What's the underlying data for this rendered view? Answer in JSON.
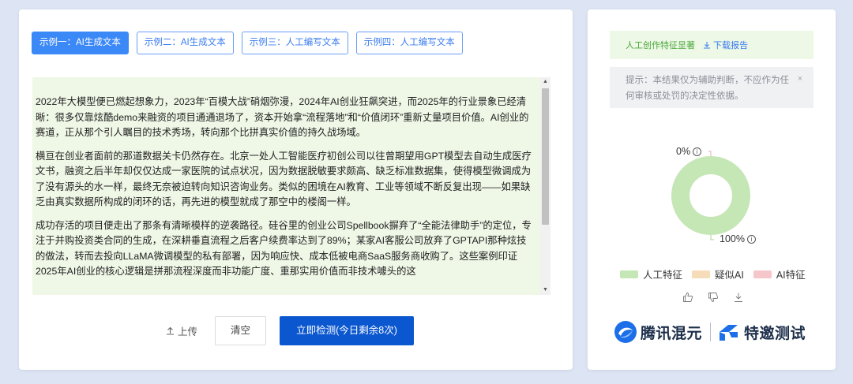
{
  "tabs": [
    {
      "label": "示例一：AI生成文本",
      "active": true
    },
    {
      "label": "示例二：AI生成文本",
      "active": false
    },
    {
      "label": "示例三：人工编写文本",
      "active": false
    },
    {
      "label": "示例四：人工编写文本",
      "active": false
    }
  ],
  "content": {
    "paragraphs": [
      "2022年大模型便已燃起想象力，2023年“百模大战”硝烟弥漫，2024年AI创业狂飙突进，而2025年的行业景象已经清晰：很多仅靠炫酷demo来融资的项目通通退场了，资本开始拿“流程落地”和“价值闭环”重新丈量项目价值。AI创业的赛道，正从那个引人瞩目的技术秀场，转向那个比拼真实价值的持久战场域。",
      "横亘在创业者面前的那道数据关卡仍然存在。北京一处人工智能医疗初创公司以往曾期望用GPT模型去自动生成医疗文书，融资之后半年却仅仅达成一家医院的试点状况，因为数据脱敏要求颇高、缺乏标准数据集，使得模型微调成为了没有源头的水一样，最终无奈被迫转向知识咨询业务。类似的困境在AI教育、工业等领域不断反复出现——如果缺乏由真实数据所构成的闭环的话，再先进的模型就成了那空中的楼阁一样。",
      "成功存活的项目便走出了那条有清晰模样的逆袭路径。硅谷里的创业公司Spellbook摒弃了“全能法律助手”的定位，专注于并购投资类合同的生成，在深耕垂直流程之后客户续费率达到了89%；某家AI客服公司放弃了GPTAPI那种炫技的做法，转而去投向LLaMA微调模型的私有部署，因为响应快、成本低被电商SaaS服务商收购了。这些案例印证2025年AI创业的核心逻辑是拼那流程深度而非功能广度、重那实用价值而非技术噱头的这"
    ]
  },
  "actions": {
    "upload_label": "上传",
    "clear_label": "清空",
    "detect_label": "立即检测(今日剩余8次)"
  },
  "result": {
    "label": "人工创作特征显著",
    "download_label": "下载报告",
    "notice": "提示：本结果仅为辅助判断，不应作为任何审核或处罚的决定性依据。",
    "close_glyph": "×"
  },
  "chart_data": {
    "type": "pie",
    "categories": [
      "人工特征",
      "疑似AI",
      "AI特征"
    ],
    "values": [
      100,
      0,
      0
    ],
    "labels": [
      "100%",
      "0%"
    ],
    "colors": [
      "#c5e6b5",
      "#f6dcb8",
      "#f6c7ca"
    ]
  },
  "info_glyph": "i",
  "brand": {
    "name": "腾讯混元",
    "sub": "特邀测试",
    "primary_color": "#0b57d0",
    "brand_color": "#1c6fe8"
  }
}
